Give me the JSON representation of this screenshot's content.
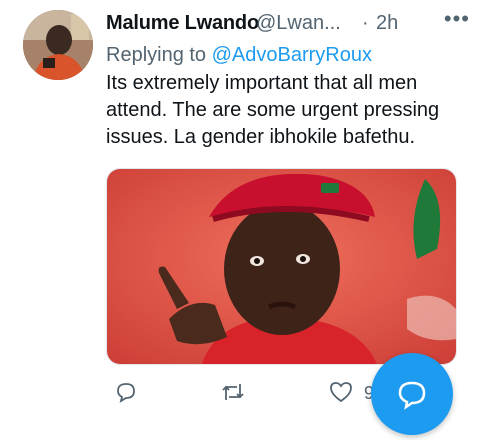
{
  "tweet": {
    "author_name": "Malume Lwando",
    "handle": "@Lwan...",
    "separator": "·",
    "time": "2h",
    "more_label": "•••",
    "replying_prefix": "Replying to",
    "replying_to": "@AdvoBarryRoux",
    "body": "Its extremely important that all men attend. The are some urgent pressing issues. La gender ibhokile bafethu.",
    "media_description_icon": "photo-media",
    "like_count": "9"
  },
  "actions": {
    "reply_icon": "reply-icon",
    "retweet_icon": "retweet-icon",
    "like_icon": "heart-icon",
    "compose_icon": "compose-reply-icon"
  },
  "colors": {
    "accent": "#1d9bf0",
    "secondary_text": "#536471",
    "beret": "#c8102e",
    "photo_background": "#e0463f"
  }
}
